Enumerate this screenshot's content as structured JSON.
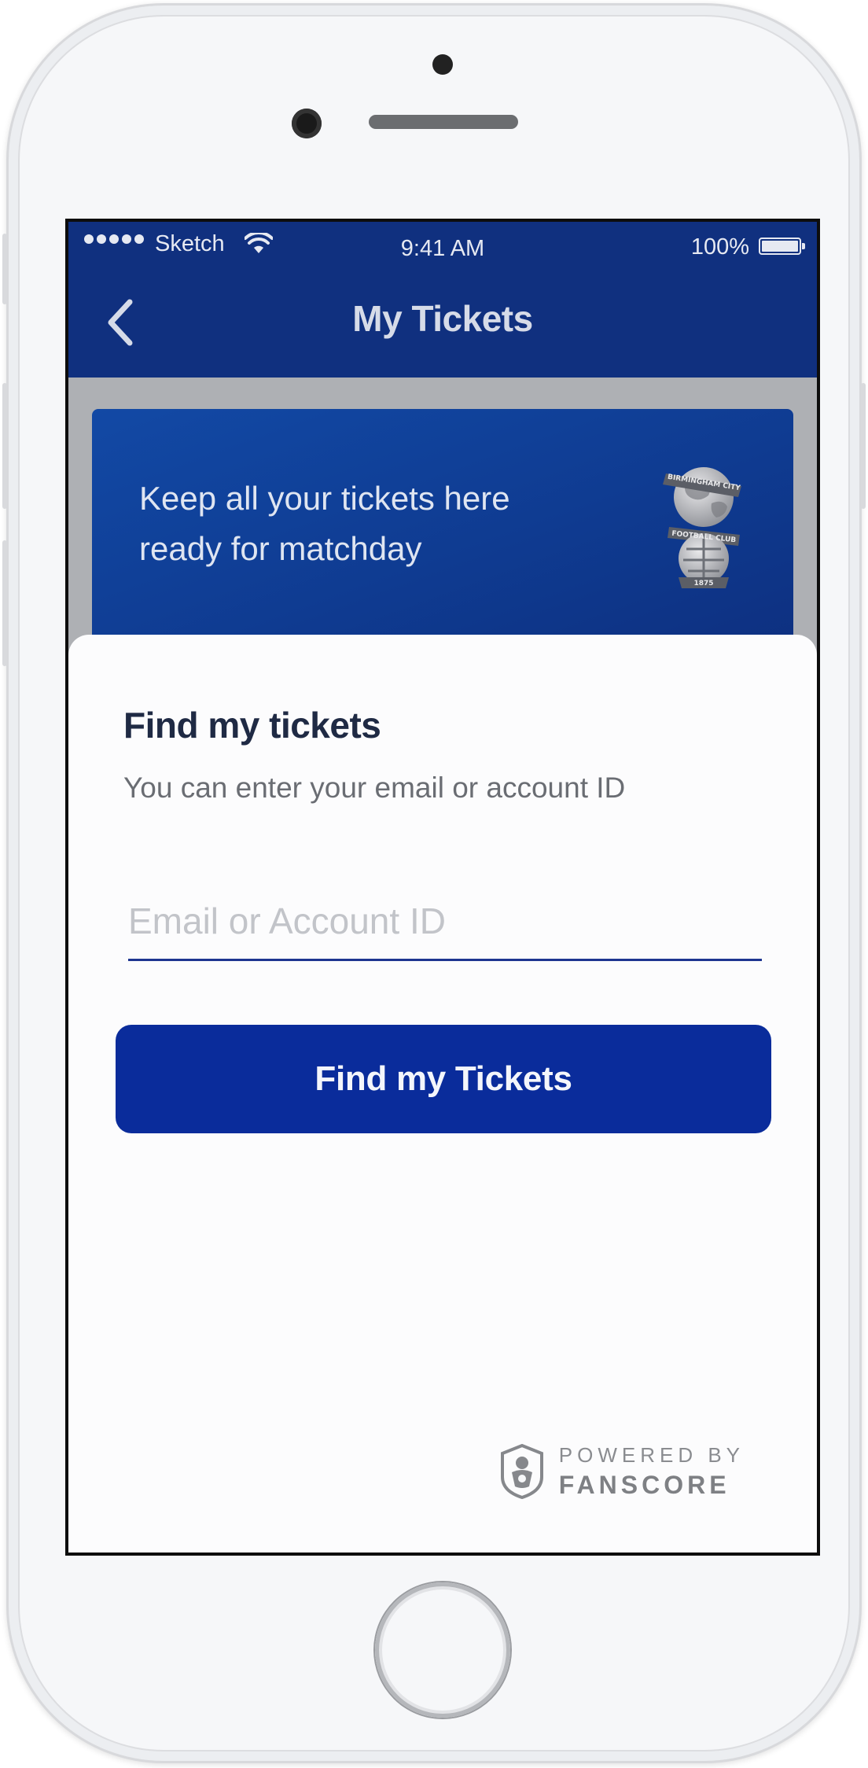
{
  "status_bar": {
    "carrier": "Sketch",
    "time": "9:41 AM",
    "battery": "100%"
  },
  "nav": {
    "title": "My Tickets"
  },
  "promo": {
    "text": "Keep all your tickets here ready for matchday",
    "crest_icon": "birmingham-city-crest-icon",
    "crest_lettering": [
      "BIRMINGHAM CITY",
      "FOOTBALL CLUB",
      "1875"
    ]
  },
  "find": {
    "title": "Find my tickets",
    "subtitle": "You can enter your email or account ID",
    "input_placeholder": "Email or Account ID",
    "input_value": "",
    "button_label": "Find my Tickets"
  },
  "footer": {
    "powered_by": "POWERED BY",
    "brand": "FANSCORE"
  },
  "colors": {
    "nav_bg": "#10307f",
    "button_bg": "#0a2c9b",
    "input_underline": "#1e3590",
    "title_text": "#1f2a44"
  }
}
